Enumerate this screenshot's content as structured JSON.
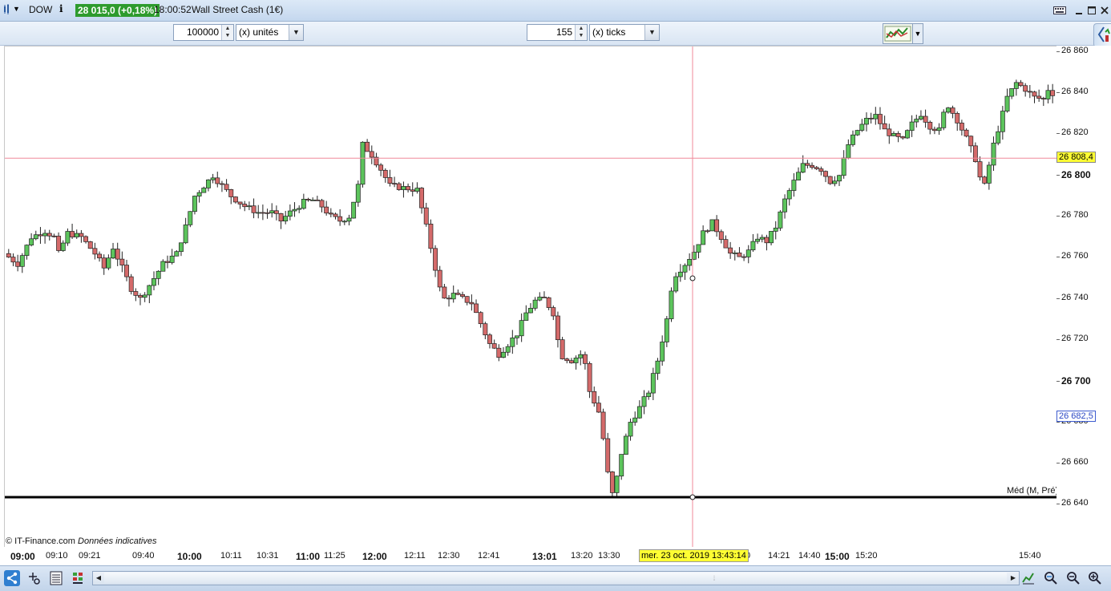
{
  "title_bar": {
    "symbol": "DOW",
    "price_badge": "28 015,0 (+0,18%)",
    "time": "18:00:52",
    "instrument": "Wall Street Cash (1€)"
  },
  "toolbar": {
    "units_value": "100000",
    "units_label": "(x) unités",
    "ticks_value": "155",
    "ticks_label": "(x) ticks"
  },
  "y_axis": {
    "ticks": [
      {
        "label": "26 860",
        "bold": false
      },
      {
        "label": "26 840",
        "bold": false
      },
      {
        "label": "26 820",
        "bold": false
      },
      {
        "label": "26 800",
        "bold": true
      },
      {
        "label": "26 780",
        "bold": false
      },
      {
        "label": "26 760",
        "bold": false
      },
      {
        "label": "26 740",
        "bold": false
      },
      {
        "label": "26 720",
        "bold": false
      },
      {
        "label": "26 700",
        "bold": true
      },
      {
        "label": "26 680",
        "bold": false
      },
      {
        "label": "26 660",
        "bold": false
      },
      {
        "label": "26 640",
        "bold": false
      }
    ],
    "crosshair_value": "26 808,4",
    "last_value": "26 682,5"
  },
  "x_axis": {
    "ticks": [
      {
        "label": "09:00",
        "bold": true
      },
      {
        "label": "09:10",
        "bold": false
      },
      {
        "label": "09:21",
        "bold": false
      },
      {
        "label": "09:40",
        "bold": false
      },
      {
        "label": "10:00",
        "bold": true
      },
      {
        "label": "10:11",
        "bold": false
      },
      {
        "label": "10:31",
        "bold": false
      },
      {
        "label": "11:00",
        "bold": true
      },
      {
        "label": "11:25",
        "bold": false
      },
      {
        "label": "12:00",
        "bold": true
      },
      {
        "label": "12:11",
        "bold": false
      },
      {
        "label": "12:30",
        "bold": false
      },
      {
        "label": "12:41",
        "bold": false
      },
      {
        "label": "13:01",
        "bold": true
      },
      {
        "label": "13:20",
        "bold": false
      },
      {
        "label": "13:30",
        "bold": false
      },
      {
        "label": "0",
        "bold": false
      },
      {
        "label": "14:21",
        "bold": false
      },
      {
        "label": "14:40",
        "bold": false
      },
      {
        "label": "15:00",
        "bold": true
      },
      {
        "label": "15:20",
        "bold": false
      },
      {
        "label": "15:40",
        "bold": false
      }
    ],
    "crosshair_date": "mer. 23 oct. 2019 13:43:14"
  },
  "chart_labels": {
    "copyright": "© IT-Finance.com",
    "disclaimer": "Données indicatives",
    "median_label": "Méd (M, Pré)"
  },
  "chart_data": {
    "type": "candlestick",
    "x_range": [
      "09:00",
      "15:45"
    ],
    "ylim": [
      26630,
      26865
    ],
    "up_color": "#5cc45c",
    "down_color": "#d46a6a",
    "close_path": [
      [
        0,
        26762
      ],
      [
        3,
        26757
      ],
      [
        6,
        26770
      ],
      [
        9,
        26773
      ],
      [
        11,
        26770
      ],
      [
        12,
        26762
      ],
      [
        14,
        26772
      ],
      [
        17,
        26770
      ],
      [
        20,
        26762
      ],
      [
        22,
        26755
      ],
      [
        24,
        26765
      ],
      [
        26,
        26755
      ],
      [
        28,
        26745
      ],
      [
        30,
        26740
      ],
      [
        33,
        26750
      ],
      [
        35,
        26757
      ],
      [
        38,
        26762
      ],
      [
        40,
        26775
      ],
      [
        42,
        26790
      ],
      [
        44,
        26795
      ],
      [
        46,
        26800
      ],
      [
        48,
        26795
      ],
      [
        50,
        26790
      ],
      [
        53,
        26785
      ],
      [
        56,
        26782
      ],
      [
        59,
        26782
      ],
      [
        61,
        26778
      ],
      [
        63,
        26782
      ],
      [
        66,
        26787
      ],
      [
        68,
        26788
      ],
      [
        70,
        26785
      ],
      [
        72,
        26780
      ],
      [
        74,
        26778
      ],
      [
        76,
        26780
      ],
      [
        78,
        26795
      ],
      [
        79,
        26815
      ],
      [
        81,
        26810
      ],
      [
        83,
        26803
      ],
      [
        85,
        26795
      ],
      [
        88,
        26794
      ],
      [
        91,
        26793
      ],
      [
        93,
        26775
      ],
      [
        95,
        26755
      ],
      [
        96,
        26745
      ],
      [
        97,
        26740
      ],
      [
        99,
        26742
      ],
      [
        101,
        26740
      ],
      [
        103,
        26738
      ],
      [
        105,
        26728
      ],
      [
        107,
        26718
      ],
      [
        109,
        26713
      ],
      [
        111,
        26718
      ],
      [
        113,
        26723
      ],
      [
        115,
        26733
      ],
      [
        117,
        26739
      ],
      [
        119,
        26740
      ],
      [
        121,
        26733
      ],
      [
        122,
        26720
      ],
      [
        123,
        26712
      ],
      [
        125,
        26710
      ],
      [
        127,
        26713
      ],
      [
        128,
        26708
      ],
      [
        129,
        26695
      ],
      [
        131,
        26685
      ],
      [
        132,
        26672
      ],
      [
        133,
        26655
      ],
      [
        134,
        26645
      ],
      [
        135,
        26653
      ],
      [
        136,
        26665
      ],
      [
        138,
        26680
      ],
      [
        140,
        26687
      ],
      [
        142,
        26695
      ],
      [
        144,
        26710
      ],
      [
        146,
        26730
      ],
      [
        147,
        26745
      ],
      [
        148,
        26752
      ],
      [
        150,
        26757
      ],
      [
        152,
        26763
      ],
      [
        154,
        26772
      ],
      [
        156,
        26777
      ],
      [
        158,
        26770
      ],
      [
        160,
        26762
      ],
      [
        162,
        26760
      ],
      [
        164,
        26763
      ],
      [
        166,
        26770
      ],
      [
        168,
        26768
      ],
      [
        170,
        26775
      ],
      [
        172,
        26788
      ],
      [
        174,
        26797
      ],
      [
        176,
        26805
      ],
      [
        178,
        26805
      ],
      [
        180,
        26803
      ],
      [
        182,
        26797
      ],
      [
        184,
        26800
      ],
      [
        186,
        26815
      ],
      [
        188,
        26822
      ],
      [
        190,
        26827
      ],
      [
        192,
        26829
      ],
      [
        194,
        26822
      ],
      [
        196,
        26819
      ],
      [
        198,
        26817
      ],
      [
        200,
        26825
      ],
      [
        202,
        26830
      ],
      [
        204,
        26824
      ],
      [
        206,
        26822
      ],
      [
        207,
        26830
      ],
      [
        208,
        26834
      ],
      [
        210,
        26827
      ],
      [
        212,
        26818
      ],
      [
        213,
        26813
      ],
      [
        214,
        26808
      ],
      [
        215,
        26799
      ],
      [
        216,
        26795
      ],
      [
        217,
        26805
      ],
      [
        218,
        26815
      ],
      [
        220,
        26830
      ],
      [
        221,
        26838
      ],
      [
        223,
        26845
      ],
      [
        225,
        26842
      ],
      [
        227,
        26838
      ],
      [
        229,
        26837
      ],
      [
        230,
        26842
      ],
      [
        231,
        26840
      ]
    ],
    "crosshair_price": 26808.4,
    "crosshair_time": "mer. 23 oct. 2019 13:43:14",
    "median_price": 26643.5,
    "last_price": 26682.5
  }
}
